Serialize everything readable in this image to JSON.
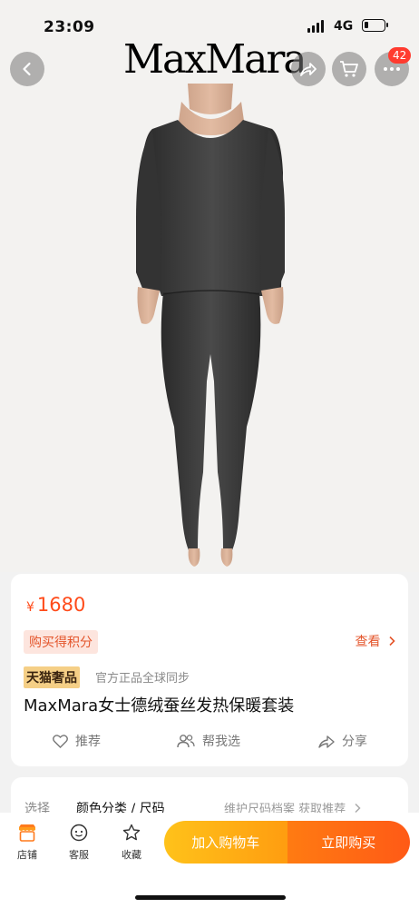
{
  "status_bar": {
    "time": "23:09",
    "network": "4G"
  },
  "brand": "MaxMara",
  "header": {
    "cart_badge": "42"
  },
  "product": {
    "currency": "¥",
    "price": "1680",
    "points_tag": "购买得积分",
    "view_link": "查看",
    "store_badge": "天猫奢品",
    "authentic_note": "官方正品全球同步",
    "title": "MaxMara女士德绒蚕丝发热保暖套装",
    "actions": {
      "recommend": "推荐",
      "help_choose": "帮我选",
      "share": "分享"
    }
  },
  "selection": {
    "label": "选择",
    "value": "颜色分类 / 尺码",
    "right": "维护尺码档案 获取推荐"
  },
  "bottom_bar": {
    "tabs": {
      "shop": "店铺",
      "service": "客服",
      "favorite": "收藏"
    },
    "add_to_cart": "加入购物车",
    "buy_now": "立即购买"
  },
  "colors": {
    "accent": "#ff4b1a",
    "cart_gradient": "#ffc21a",
    "buy_gradient": "#ff5a16",
    "badge": "#ff3b2f"
  },
  "icons": [
    "back-icon",
    "share-icon",
    "cart-icon",
    "more-icon",
    "heart-icon",
    "people-icon",
    "share-arrow-icon",
    "shop-icon",
    "service-icon",
    "star-icon",
    "chevron-right-icon"
  ]
}
